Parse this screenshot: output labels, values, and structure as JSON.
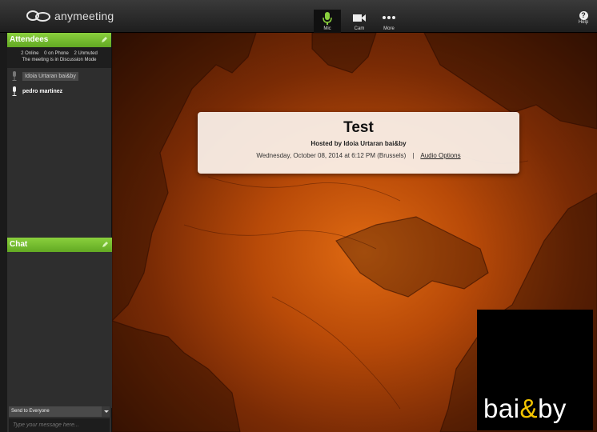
{
  "topbar": {
    "logo_text": "anymeeting",
    "tools": [
      {
        "label": "Mic",
        "icon": "mic-icon"
      },
      {
        "label": "Cam",
        "icon": "camera-icon"
      },
      {
        "label": "More",
        "icon": "more-icon"
      }
    ],
    "help_label": "Help",
    "help_glyph": "?"
  },
  "attendees": {
    "title": "Attendees",
    "stats_line": "2 Online    0 on Phone    2 Unmuted",
    "mode_line": "The meeting is in Discussion Mode",
    "list": [
      {
        "name": "Idoia Urtaran bai&by"
      },
      {
        "name": "pedro martinez"
      }
    ]
  },
  "chat": {
    "title": "Chat",
    "send_to": "Send to Everyone",
    "message_placeholder": "Type your message here..."
  },
  "meeting": {
    "title": "Test",
    "host": "Hosted by Idoia Urtaran bai&by",
    "datetime": "Wednesday, October 08, 2014 at 6:12 PM (Brussels)",
    "separator": "|",
    "audio_options": "Audio Options"
  },
  "brand": {
    "part1": "bai",
    "amp": "&",
    "part2": "by"
  },
  "colors": {
    "accent_green": "#6cbf2a",
    "stage_orange": "#e06a12",
    "brand_amp": "#f2c400"
  }
}
